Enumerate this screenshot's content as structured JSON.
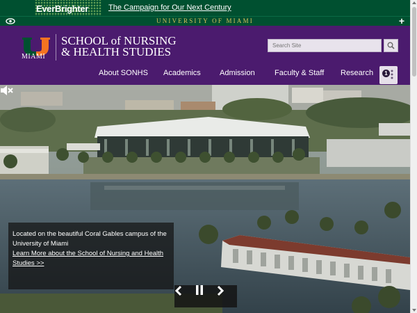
{
  "campaign": {
    "logo_text": "EverBrighter",
    "link_text": "The Campaign for Our Next Century"
  },
  "um_bar": {
    "title": "UNIVERSITY OF MIAMI",
    "eye_icon": "eye-icon",
    "plus_icon": "plus-icon"
  },
  "header": {
    "logo_word": "MIAMI",
    "school_line1": "SCHOOL of NURSING",
    "school_line2": "& HEALTH STUDIES",
    "search_placeholder": "Search Site",
    "search_icon": "search-icon"
  },
  "nav": {
    "items": [
      "About SONHS",
      "Academics",
      "Admission",
      "Faculty & Staff",
      "Research"
    ],
    "badge": "1",
    "more_icon": "more-vertical-icon"
  },
  "hero": {
    "caption_text": "Located on the beautiful Coral Gables campus of the University of Miami",
    "caption_link": "Learn More about the School of Nursing and Health Studies >>",
    "controls": [
      "previous-icon",
      "pause-icon",
      "next-icon"
    ],
    "mute_icon": "speaker-muted-icon"
  },
  "colors": {
    "green": "#005030",
    "purple": "#4b1b6e",
    "orange": "#f47321",
    "gold": "#d9c15a"
  }
}
